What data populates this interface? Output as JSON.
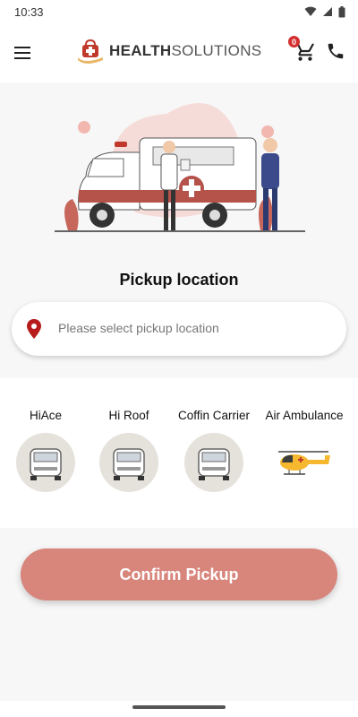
{
  "status_bar": {
    "time": "10:33"
  },
  "header": {
    "logo_bold": "HEALTH",
    "logo_light": "SOLUTIONS",
    "cart_count": "0"
  },
  "pickup": {
    "title": "Pickup location",
    "placeholder": "Please select pickup location"
  },
  "vehicles": [
    {
      "label": "HiAce",
      "icon": "van-icon"
    },
    {
      "label": "Hi Roof",
      "icon": "van-icon"
    },
    {
      "label": "Coffin Carrier",
      "icon": "van-icon"
    },
    {
      "label": "Air Ambulance",
      "icon": "helicopter-icon"
    }
  ],
  "confirm": {
    "label": "Confirm Pickup"
  },
  "colors": {
    "accent": "#d8857c",
    "brand_red": "#c0392b",
    "background": "#f7f7f7"
  }
}
